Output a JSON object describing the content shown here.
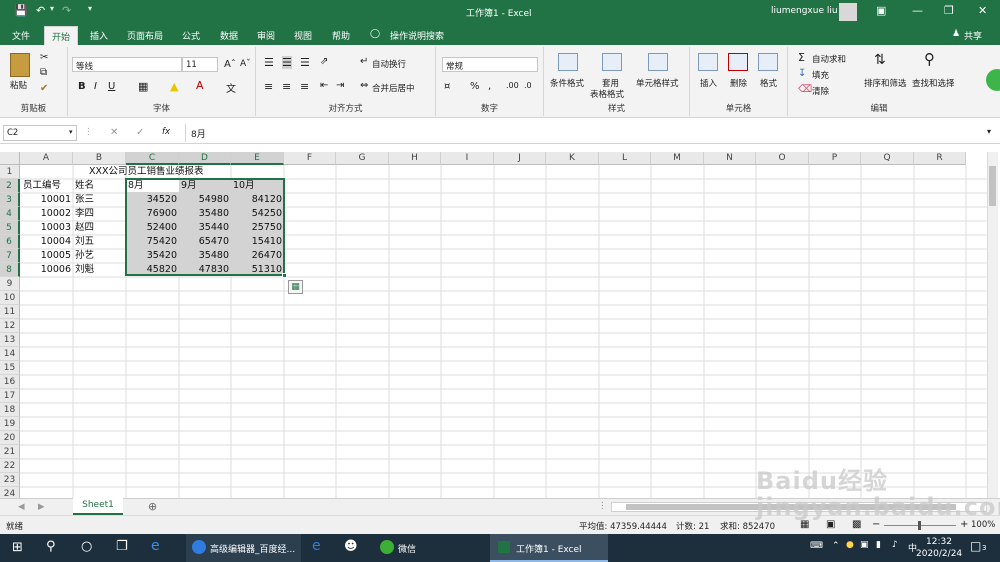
{
  "window": {
    "title": "工作簿1 - Excel",
    "user": "liumengxue liu"
  },
  "menu": {
    "items": [
      "文件",
      "开始",
      "插入",
      "页面布局",
      "公式",
      "数据",
      "审阅",
      "视图",
      "帮助"
    ],
    "search": "操作说明搜索",
    "share": "共享"
  },
  "ribbon": {
    "font_name": "等线",
    "font_size": "11",
    "wrap": "自动换行",
    "merge": "合并后居中",
    "number_format": "常规",
    "paste": "粘贴",
    "cond_format": "条件格式",
    "table_format_1": "套用",
    "table_format_2": "表格格式",
    "cell_style": "单元格样式",
    "insert": "插入",
    "delete": "删除",
    "format": "格式",
    "autosum": "自动求和",
    "fill": "填充",
    "clear": "清除",
    "sort_filter": "排序和筛选",
    "find_select": "查找和选择",
    "groups": {
      "clipboard": "剪贴板",
      "font": "字体",
      "alignment": "对齐方式",
      "number": "数字",
      "styles": "样式",
      "cells": "单元格",
      "editing": "编辑"
    }
  },
  "formula_bar": {
    "name_box": "C2",
    "fx": "fx",
    "value": "8月"
  },
  "columns": [
    "A",
    "B",
    "C",
    "D",
    "E",
    "F",
    "G",
    "H",
    "I",
    "J",
    "K",
    "L",
    "M",
    "N",
    "O",
    "P",
    "Q",
    "R"
  ],
  "rows": [
    "1",
    "2",
    "3",
    "4",
    "5",
    "6",
    "7",
    "8",
    "9",
    "10",
    "11",
    "12",
    "13",
    "14",
    "15",
    "16",
    "17",
    "18",
    "19",
    "20",
    "21",
    "22",
    "23",
    "24"
  ],
  "sheet": {
    "title": "XXX公司员工销售业绩报表",
    "header": [
      "员工编号",
      "姓名",
      "8月",
      "9月",
      "10月"
    ],
    "data": [
      [
        "10001",
        "张三",
        "34520",
        "54980",
        "84120"
      ],
      [
        "10002",
        "李四",
        "76900",
        "35480",
        "54250"
      ],
      [
        "10003",
        "赵四",
        "52400",
        "35440",
        "25750"
      ],
      [
        "10004",
        "刘五",
        "75420",
        "65470",
        "15410"
      ],
      [
        "10005",
        "孙艺",
        "35420",
        "35480",
        "26470"
      ],
      [
        "10006",
        "刘魁",
        "45820",
        "47830",
        "51310"
      ]
    ]
  },
  "tabs": {
    "sheet1": "Sheet1"
  },
  "status": {
    "ready": "就绪",
    "average": "平均值: 47359.44444",
    "count": "计数: 21",
    "sum": "求和: 852470",
    "zoom": "100%"
  },
  "taskbar": {
    "app1": "高级编辑器_百度经...",
    "app2": "微信",
    "app3": "工作簿1 - Excel",
    "time": "12:32",
    "date": "2020/2/24",
    "ime": "中",
    "notif": "3"
  },
  "watermark": "Baidu经验 jingyan.baidu.com"
}
